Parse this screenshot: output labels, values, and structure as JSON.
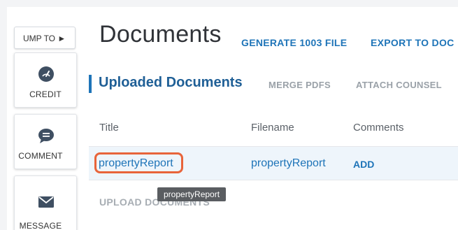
{
  "sidebar": {
    "jump_label": "UMP TO ►",
    "items": [
      {
        "label": "CREDIT",
        "icon": "gauge-icon"
      },
      {
        "label": "COMMENT",
        "icon": "comment-icon"
      },
      {
        "label": "MESSAGE",
        "icon": "envelope-icon"
      }
    ]
  },
  "header": {
    "title": "Documents",
    "actions": {
      "generate": "GENERATE 1003 FILE",
      "export": "EXPORT TO DOC"
    }
  },
  "section": {
    "title": "Uploaded Documents",
    "actions": {
      "merge": "MERGE PDFS",
      "attach": "ATTACH COUNSEL"
    }
  },
  "table": {
    "columns": {
      "title": "Title",
      "filename": "Filename",
      "comments": "Comments"
    },
    "rows": [
      {
        "title": "propertyReport",
        "filename": "propertyReport",
        "comments": "ADD"
      }
    ]
  },
  "upload_label": "UPLOAD DOCUMENTS",
  "tooltip": "propertyReport",
  "colors": {
    "accent": "#1e74b8",
    "highlight": "#e8643a",
    "row_bg": "#eef5fb"
  }
}
